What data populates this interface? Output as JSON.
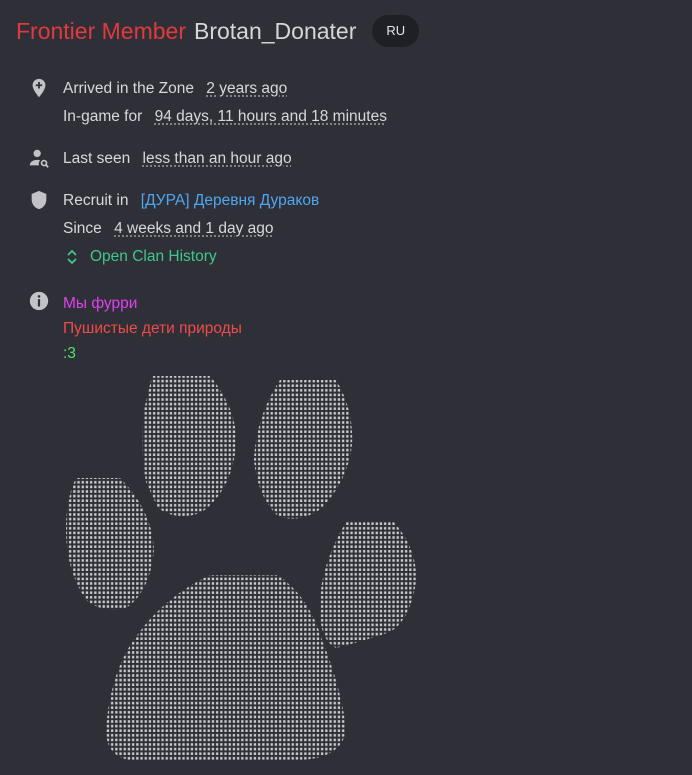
{
  "header": {
    "rank": "Frontier Member",
    "username": "Brotan_Donater",
    "region_badge": "RU"
  },
  "info": {
    "arrived_label": "Arrived in the Zone",
    "arrived_value": "2 years ago",
    "ingame_label": "In-game for",
    "ingame_value": "94 days, 11 hours and 18 minutes",
    "lastseen_label": "Last seen",
    "lastseen_value": "less than an hour ago",
    "clan_label": "Recruit in",
    "clan_name": "[ДУРА] Деревня Дураков",
    "since_label": "Since",
    "since_value": "4 weeks and 1 day ago",
    "history_label": "Open Clan History"
  },
  "bio": {
    "line1": "Мы фурри",
    "line2": "Пушистые дети природы",
    "line3": ":3"
  },
  "icons": {
    "arrived": "location-pin-plus-icon",
    "lastseen": "user-search-icon",
    "clan": "shield-icon",
    "history": "chevron-up-down-icon",
    "about": "info-icon"
  },
  "colors": {
    "rank": "#e0393e",
    "clan_link": "#4ea6f2",
    "history_link": "#3fc78e",
    "bio1": "#e040f0",
    "bio2": "#f04a4a",
    "bio3": "#4fe36a"
  }
}
